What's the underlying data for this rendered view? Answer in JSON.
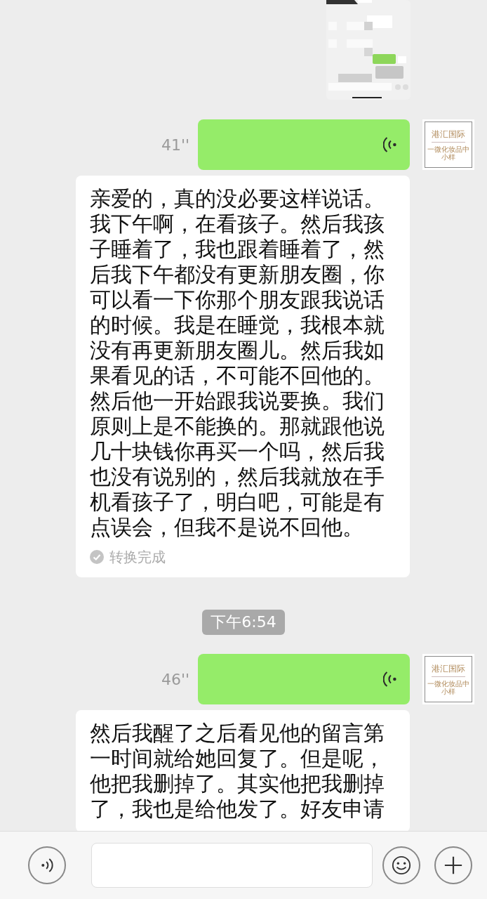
{
  "messages": [
    {
      "kind": "voice",
      "duration": "41''",
      "avatar": {
        "title": "港汇国际",
        "subtitle": "一微化妆品中小样"
      }
    },
    {
      "kind": "transcript",
      "text": "亲爱的，真的没必要这样说话。我下午啊，在看孩子。然后我孩子睡着了，我也跟着睡着了，然后我下午都没有更新朋友圈，你可以看一下你那个朋友跟我说话的时候。我是在睡觉，我根本就没有再更新朋友圈儿。然后我如果看见的话，不可能不回他的。然后他一开始跟我说要换。我们原则上是不能换的。那就跟他说几十块钱你再买一个吗，然后我也没有说别的，然后我就放在手机看孩子了，明白吧，可能是有点误会，但我不是说不回他。",
      "status": "转换完成"
    },
    {
      "kind": "timestamp",
      "text": "下午6:54"
    },
    {
      "kind": "voice",
      "duration": "46''",
      "avatar": {
        "title": "港汇国际",
        "subtitle": "一微化妆品中小样"
      }
    },
    {
      "kind": "transcript",
      "text": "然后我醒了之后看见他的留言第一时间就给她回复了。但是呢，他把我删掉了。其实他把我删掉了，我也是给他发了。好友申请"
    }
  ]
}
